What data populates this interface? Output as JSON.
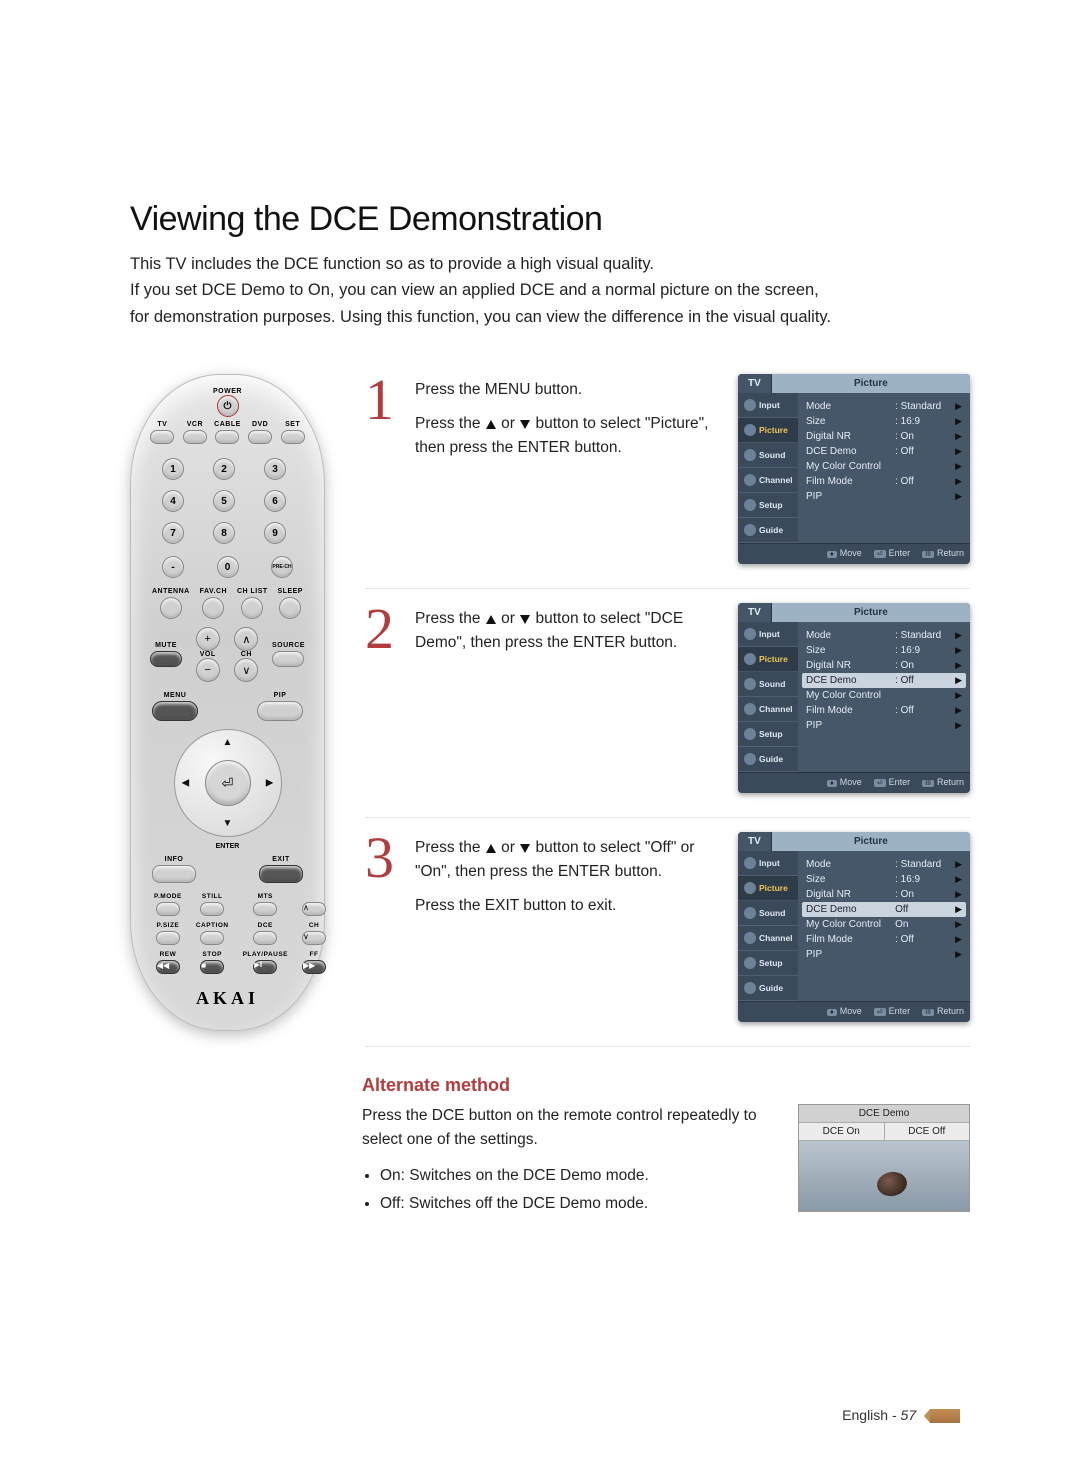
{
  "page_title": "Viewing the DCE Demonstration",
  "intro_lines": [
    "This TV includes the DCE function so as to provide a high visual quality.",
    "If you set DCE Demo to On, you can view an applied DCE and a normal picture on the screen,",
    "for demonstration purposes. Using this function, you can view the difference in the visual quality."
  ],
  "remote": {
    "brand": "AKAI",
    "power": "POWER",
    "device_row": [
      "TV",
      "VCR",
      "CABLE",
      "DVD",
      "SET"
    ],
    "numpad": [
      "1",
      "2",
      "3",
      "4",
      "5",
      "6",
      "7",
      "8",
      "9"
    ],
    "dash": "-",
    "zero": "0",
    "prech": "PRE-CH",
    "row_a": [
      "ANTENNA",
      "FAV.CH",
      "CH LIST",
      "SLEEP"
    ],
    "vol_lbl": "VOL",
    "ch_lbl": "CH",
    "mute": "MUTE",
    "source": "SOURCE",
    "menu": "MENU",
    "pip": "PIP",
    "enter": "ENTER",
    "info": "INFO",
    "exit": "EXIT",
    "fn_row1": [
      "P.MODE",
      "STILL",
      "MTS",
      ""
    ],
    "fn_row2": [
      "P.SIZE",
      "CAPTION",
      "DCE",
      "CH"
    ],
    "fn_row3": [
      "REW",
      "STOP",
      "PLAY/PAUSE",
      "FF"
    ]
  },
  "steps": [
    {
      "n": "1",
      "lines": [
        "Press the MENU button.",
        "Press the ▲ or ▼ button to select \"Picture\", then press the ENTER button."
      ]
    },
    {
      "n": "2",
      "lines": [
        "Press the ▲ or ▼ button to select \"DCE Demo\", then press the ENTER button."
      ]
    },
    {
      "n": "3",
      "lines": [
        "Press the ▲ or ▼ button to select \"Off\" or \"On\", then press the ENTER button.",
        "Press the EXIT button to exit."
      ]
    }
  ],
  "osd_common": {
    "tv": "TV",
    "title": "Picture",
    "tabs": [
      "Input",
      "Picture",
      "Sound",
      "Channel",
      "Setup",
      "Guide"
    ],
    "foot": [
      "Move",
      "Enter",
      "Return"
    ]
  },
  "osd_screens": [
    {
      "selected_tab": "Picture",
      "selected_row": null,
      "rows": [
        {
          "k": "Mode",
          "v": ": Standard"
        },
        {
          "k": "Size",
          "v": ": 16:9"
        },
        {
          "k": "Digital NR",
          "v": ": On"
        },
        {
          "k": "DCE Demo",
          "v": ": Off"
        },
        {
          "k": "My Color Control",
          "v": ""
        },
        {
          "k": "Film Mode",
          "v": ": Off"
        },
        {
          "k": "PIP",
          "v": ""
        }
      ]
    },
    {
      "selected_tab": "Picture",
      "selected_row": 3,
      "rows": [
        {
          "k": "Mode",
          "v": ": Standard"
        },
        {
          "k": "Size",
          "v": ": 16:9"
        },
        {
          "k": "Digital NR",
          "v": ": On"
        },
        {
          "k": "DCE Demo",
          "v": ": Off"
        },
        {
          "k": "My Color Control",
          "v": ""
        },
        {
          "k": "Film Mode",
          "v": ": Off"
        },
        {
          "k": "PIP",
          "v": ""
        }
      ]
    },
    {
      "selected_tab": "Picture",
      "selected_row": 3,
      "rows": [
        {
          "k": "Mode",
          "v": ": Standard"
        },
        {
          "k": "Size",
          "v": ": 16:9"
        },
        {
          "k": "Digital NR",
          "v": ": On"
        },
        {
          "k": "DCE Demo",
          "v": "Off"
        },
        {
          "k": "My Color Control",
          "v": "On"
        },
        {
          "k": "Film Mode",
          "v": ": Off"
        },
        {
          "k": "PIP",
          "v": ""
        }
      ]
    }
  ],
  "alt": {
    "title": "Alternate method",
    "body": "Press the DCE button on the remote control repeatedly to select one of the settings.",
    "bullets": [
      "On: Switches on the DCE Demo mode.",
      "Off: Switches off the DCE Demo mode."
    ],
    "demo_box": {
      "title": "DCE Demo",
      "left": "DCE On",
      "right": "DCE Off"
    }
  },
  "footer": {
    "lang": "English",
    "page": "57"
  }
}
